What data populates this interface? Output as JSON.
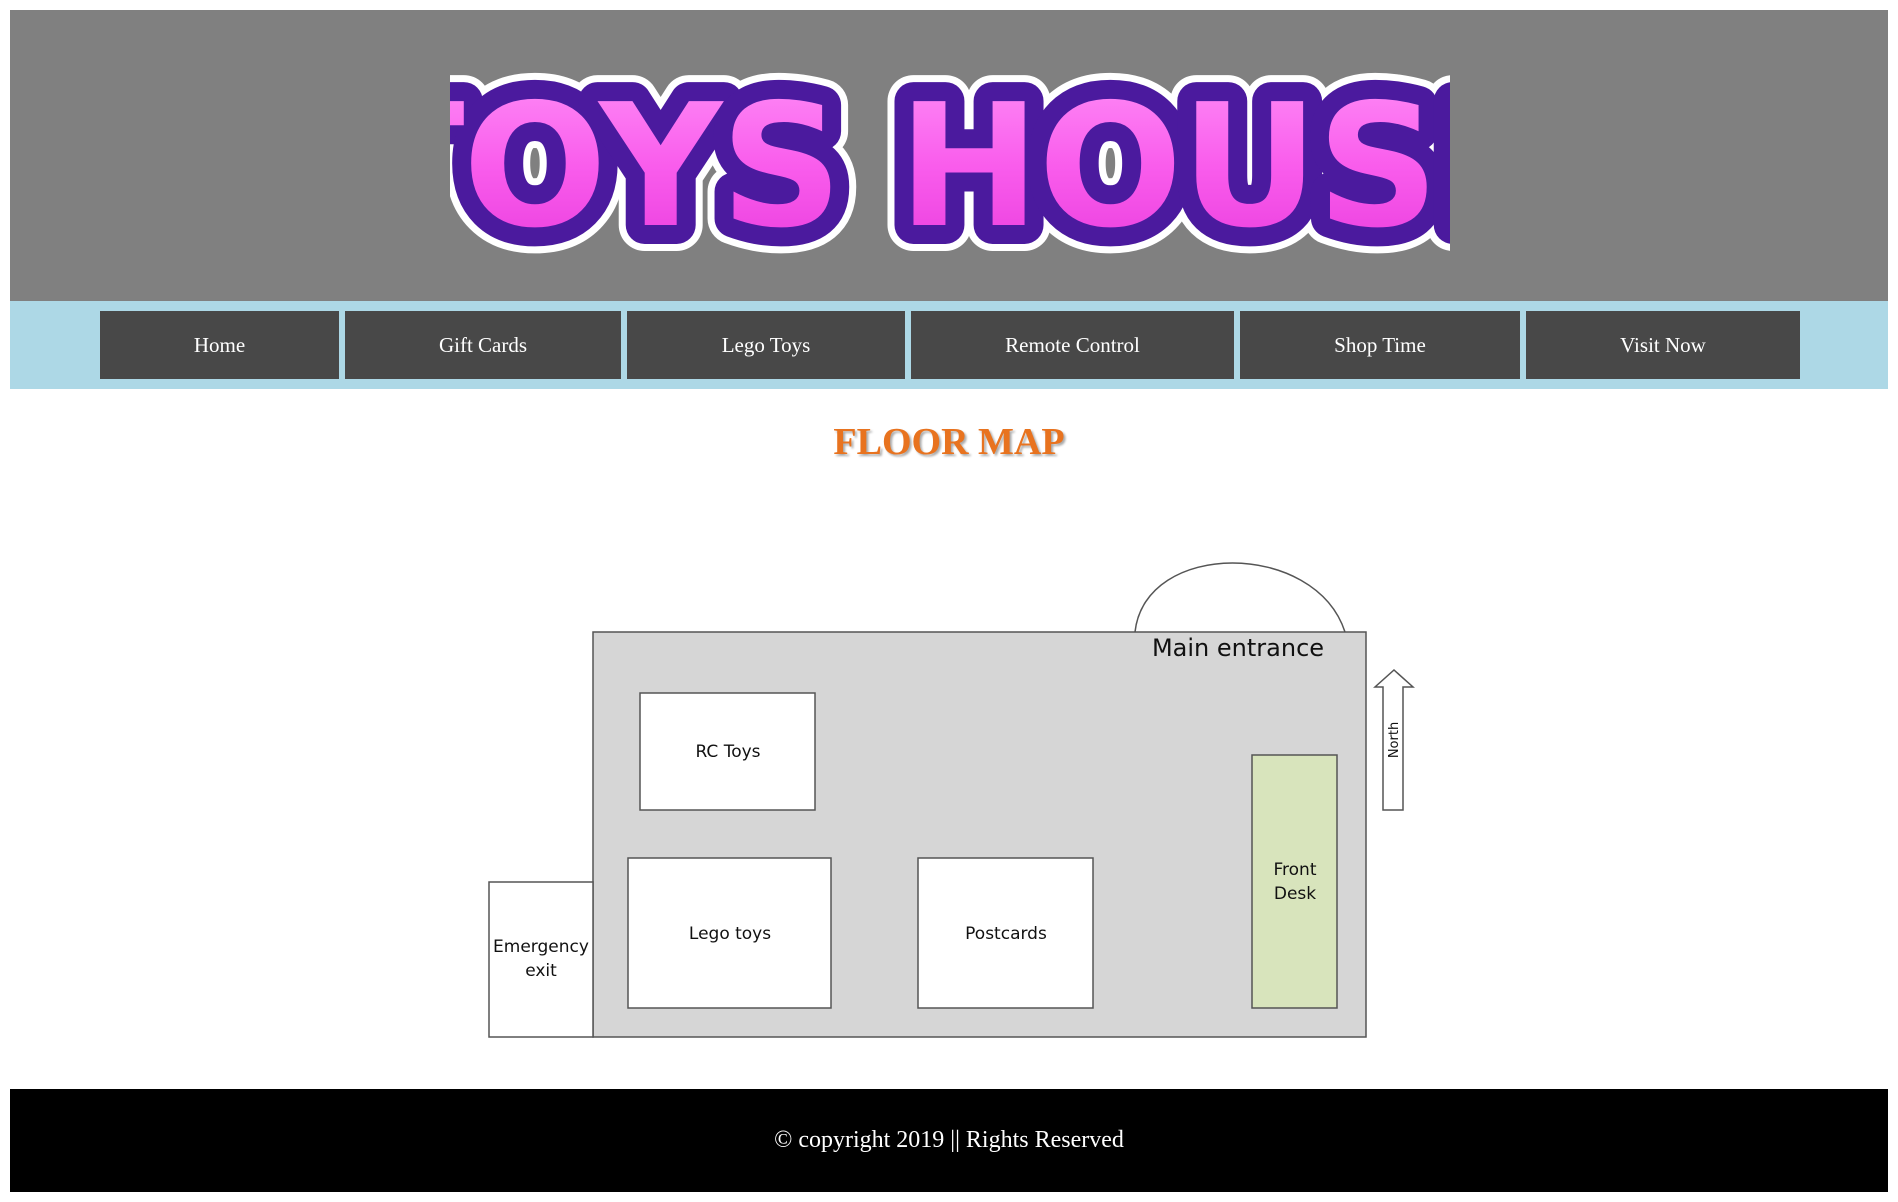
{
  "header": {
    "logo_text": "TOYS HOUSE",
    "logo_colors": {
      "fill": "#f255e8",
      "outline": "#4b1a9e",
      "banner_bg": "#808080"
    }
  },
  "nav": {
    "items": [
      {
        "label": "Home"
      },
      {
        "label": "Gift Cards"
      },
      {
        "label": "Lego Toys"
      },
      {
        "label": "Remote Control"
      },
      {
        "label": "Shop Time"
      },
      {
        "label": "Visit Now"
      }
    ]
  },
  "main": {
    "title": "FLOOR MAP",
    "title_color": "#e8731f",
    "floor_map": {
      "main_entrance": "Main entrance",
      "north": "North",
      "rc_toys": "RC Toys",
      "lego_toys": "Lego toys",
      "postcards": "Postcards",
      "front_desk_line1": "Front",
      "front_desk_line2": "Desk",
      "emergency_line1": "Emergency",
      "emergency_line2": "exit"
    }
  },
  "footer": {
    "copyright": "© copyright 2019 || Rights Reserved"
  }
}
